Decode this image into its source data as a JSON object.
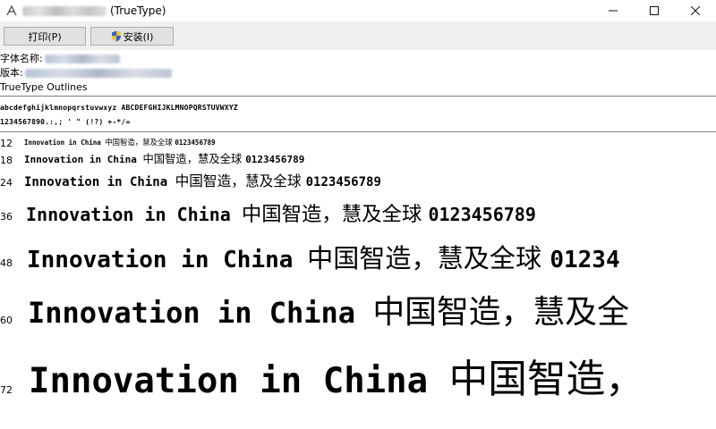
{
  "window": {
    "title_suffix": "(TrueType)",
    "app_icon": "font-icon",
    "controls": {
      "minimize": "—",
      "maximize": "☐",
      "close": "✕"
    }
  },
  "toolbar": {
    "print_label": "打印(P)",
    "install_label": "安装(I)"
  },
  "info": {
    "font_name_label": "字体名称:",
    "version_label": "版本:",
    "outlines": "TrueType Outlines"
  },
  "charset": {
    "line1": "abcdefghijklmnopqrstuvwxyz ABCDEFGHIJKLMNOPQRSTUVWXYZ",
    "line2": "1234567890.:,; ' \" (!?) +-*/="
  },
  "samples": [
    {
      "size": "12",
      "latin": "Innovation in China ",
      "cjk": "中国智造，慧及全球 ",
      "digits": "0123456789"
    },
    {
      "size": "18",
      "latin": "Innovation in China ",
      "cjk": "中国智造，慧及全球 ",
      "digits": "0123456789"
    },
    {
      "size": "24",
      "latin": "Innovation in China ",
      "cjk": "中国智造，慧及全球 ",
      "digits": "0123456789"
    },
    {
      "size": "36",
      "latin": "Innovation in China ",
      "cjk": "中国智造，慧及全球 ",
      "digits": "0123456789"
    },
    {
      "size": "48",
      "latin": "Innovation in China ",
      "cjk": "中国智造，慧及全球 ",
      "digits": "01234"
    },
    {
      "size": "60",
      "latin": "Innovation in China ",
      "cjk": "中国智造，慧及全",
      "digits": ""
    },
    {
      "size": "72",
      "latin": "Innovation in China ",
      "cjk": "中国智造，",
      "digits": ""
    }
  ]
}
